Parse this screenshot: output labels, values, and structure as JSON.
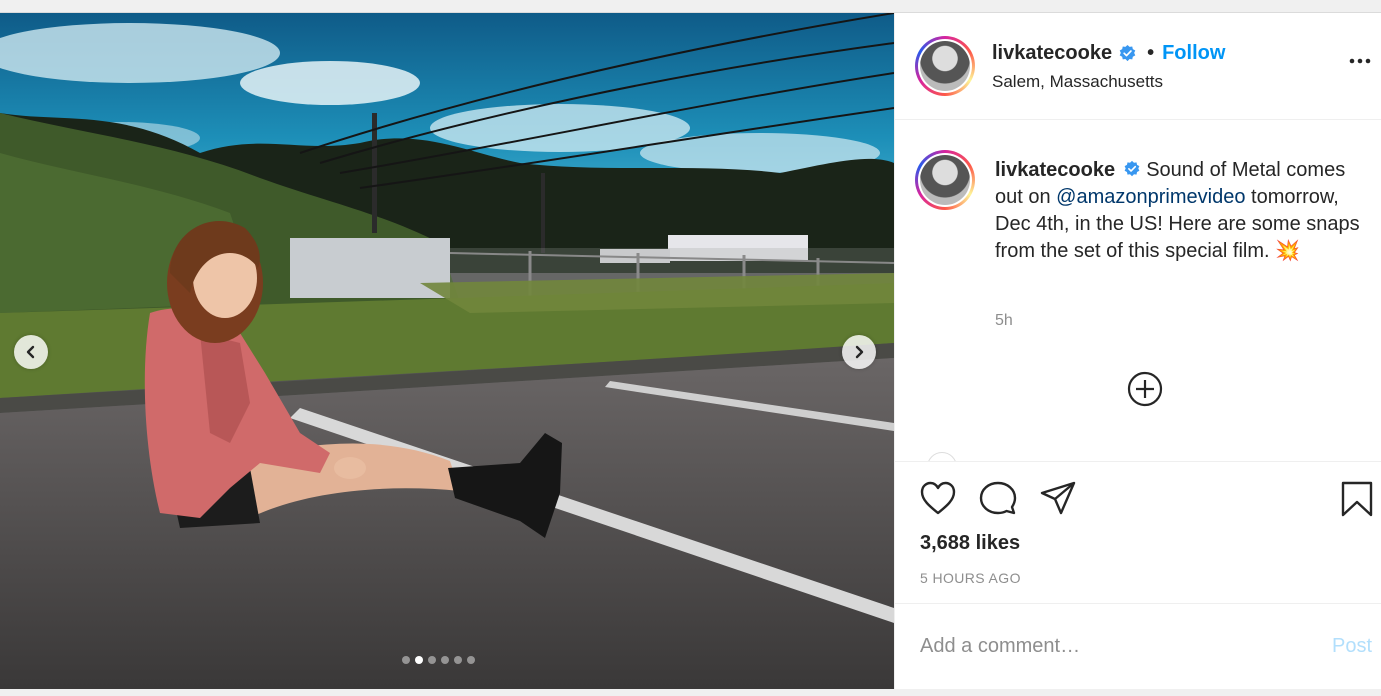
{
  "post": {
    "username": "livkatecooke",
    "location": "Salem, Massachusetts",
    "follow_label": "Follow",
    "separator": "•",
    "caption": {
      "username": "livkatecooke",
      "text_before": " Sound of Metal comes out on ",
      "mention": "@amazonprimevideo",
      "text_after": " tomorrow, Dec 4th, in the US! Here are some snaps from the set of this special film. ",
      "emoji": "💥",
      "time": "5h"
    },
    "likes": "3,688 likes",
    "posted_ago": "5 HOURS AGO",
    "comment": {
      "placeholder": "Add a comment…",
      "post_label": "Post"
    },
    "carousel": {
      "slide_count": 6,
      "active_index": 1
    }
  },
  "icons": {
    "verified": "verified-badge-icon",
    "more": "more-options-icon",
    "load_more": "load-more-comments-icon",
    "like": "heart-icon",
    "comment": "comment-icon",
    "share": "share-icon",
    "save": "bookmark-icon",
    "prev": "chevron-left-icon",
    "next": "chevron-right-icon"
  },
  "colors": {
    "accent": "#0095f6",
    "mention": "#00376b",
    "muted": "#8e8e8e",
    "post_disabled": "#b2dffc"
  }
}
